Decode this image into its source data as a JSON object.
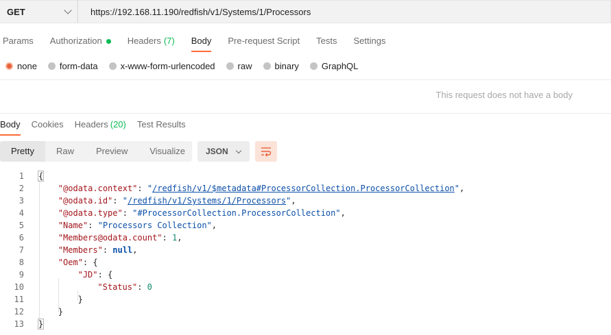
{
  "request": {
    "method": "GET",
    "url": "https://192.168.11.190/redfish/v1/Systems/1/Processors"
  },
  "request_tabs": [
    {
      "label": "Params",
      "count": "",
      "active": false
    },
    {
      "label": "Authorization",
      "count": "",
      "active": false,
      "has_dot": true
    },
    {
      "label": "Headers",
      "count": "(7)",
      "active": false
    },
    {
      "label": "Body",
      "count": "",
      "active": true
    },
    {
      "label": "Pre-request Script",
      "count": "",
      "active": false
    },
    {
      "label": "Tests",
      "count": "",
      "active": false
    },
    {
      "label": "Settings",
      "count": "",
      "active": false
    }
  ],
  "body_types": [
    {
      "label": "none",
      "selected": true
    },
    {
      "label": "form-data",
      "selected": false
    },
    {
      "label": "x-www-form-urlencoded",
      "selected": false
    },
    {
      "label": "raw",
      "selected": false
    },
    {
      "label": "binary",
      "selected": false
    },
    {
      "label": "GraphQL",
      "selected": false
    }
  ],
  "no_body_message": "This request does not have a body",
  "response_tabs": [
    {
      "label": "Body",
      "count": "",
      "active": true
    },
    {
      "label": "Cookies",
      "count": "",
      "active": false
    },
    {
      "label": "Headers",
      "count": "(20)",
      "active": false
    },
    {
      "label": "Test Results",
      "count": "",
      "active": false
    }
  ],
  "view_modes": [
    {
      "label": "Pretty",
      "active": true
    },
    {
      "label": "Raw",
      "active": false
    },
    {
      "label": "Preview",
      "active": false
    },
    {
      "label": "Visualize",
      "active": false
    }
  ],
  "format": "JSON",
  "wrap_icon": "wrap-lines-icon",
  "code_lines": [
    {
      "n": "1",
      "indent": 0,
      "tokens": [
        [
          "p",
          "{"
        ]
      ]
    },
    {
      "n": "2",
      "indent": 1,
      "tokens": [
        [
          "k",
          "\"@odata.context\""
        ],
        [
          "p",
          ": "
        ],
        [
          "s",
          "\""
        ],
        [
          "sl",
          "/redfish/v1/$metadata#ProcessorCollection.ProcessorCollection"
        ],
        [
          "s",
          "\""
        ],
        [
          "p",
          ","
        ]
      ]
    },
    {
      "n": "3",
      "indent": 1,
      "tokens": [
        [
          "k",
          "\"@odata.id\""
        ],
        [
          "p",
          ": "
        ],
        [
          "s",
          "\""
        ],
        [
          "sl",
          "/redfish/v1/Systems/1/Processors"
        ],
        [
          "s",
          "\""
        ],
        [
          "p",
          ","
        ]
      ]
    },
    {
      "n": "4",
      "indent": 1,
      "tokens": [
        [
          "k",
          "\"@odata.type\""
        ],
        [
          "p",
          ": "
        ],
        [
          "s",
          "\"#ProcessorCollection.ProcessorCollection\""
        ],
        [
          "p",
          ","
        ]
      ]
    },
    {
      "n": "5",
      "indent": 1,
      "tokens": [
        [
          "k",
          "\"Name\""
        ],
        [
          "p",
          ": "
        ],
        [
          "s",
          "\"Processors Collection\""
        ],
        [
          "p",
          ","
        ]
      ]
    },
    {
      "n": "6",
      "indent": 1,
      "tokens": [
        [
          "k",
          "\"Members@odata.count\""
        ],
        [
          "p",
          ": "
        ],
        [
          "n",
          "1"
        ],
        [
          "p",
          ","
        ]
      ]
    },
    {
      "n": "7",
      "indent": 1,
      "tokens": [
        [
          "k",
          "\"Members\""
        ],
        [
          "p",
          ": "
        ],
        [
          "kw",
          "null"
        ],
        [
          "p",
          ","
        ]
      ]
    },
    {
      "n": "8",
      "indent": 1,
      "tokens": [
        [
          "k",
          "\"Oem\""
        ],
        [
          "p",
          ": {"
        ]
      ]
    },
    {
      "n": "9",
      "indent": 2,
      "tokens": [
        [
          "k",
          "\"JD\""
        ],
        [
          "p",
          ": {"
        ]
      ]
    },
    {
      "n": "10",
      "indent": 3,
      "tokens": [
        [
          "k",
          "\"Status\""
        ],
        [
          "p",
          ": "
        ],
        [
          "n",
          "0"
        ]
      ]
    },
    {
      "n": "11",
      "indent": 2,
      "tokens": [
        [
          "p",
          "}"
        ]
      ]
    },
    {
      "n": "12",
      "indent": 1,
      "tokens": [
        [
          "p",
          "}"
        ]
      ]
    },
    {
      "n": "13",
      "indent": 0,
      "tokens": [
        [
          "p",
          "}"
        ]
      ]
    }
  ]
}
